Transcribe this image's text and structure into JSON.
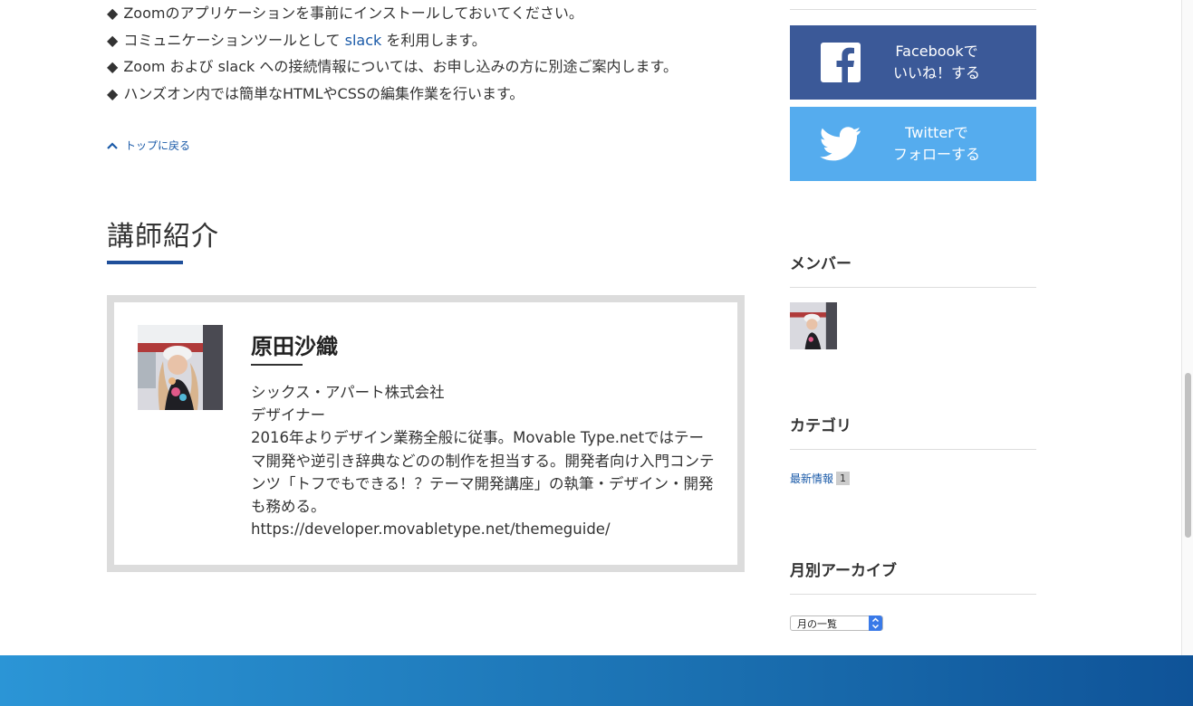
{
  "notes": [
    {
      "prefix": "◆ ",
      "text": "Zoomのアプリケーションを事前にインストールしておいてください。",
      "link": "",
      "suffix": ""
    },
    {
      "prefix": "◆ ",
      "text": "コミュニケーションツールとして ",
      "link": "slack",
      "suffix": " を利用します。"
    },
    {
      "prefix": "◆ ",
      "text": "Zoom および slack への接続情報については、お申し込みの方に別途ご案内します。",
      "link": "",
      "suffix": ""
    },
    {
      "prefix": "◆ ",
      "text": "ハンズオン内では簡単なHTMLやCSSの編集作業を行います。",
      "link": "",
      "suffix": ""
    }
  ],
  "back_to_top": "トップに戻る",
  "section_title": "講師紹介",
  "profile": {
    "name": "原田沙織",
    "lines": [
      "シックス・アパート株式会社",
      "デザイナー",
      "2016年よりデザイン業務全般に従事。Movable Type.netではテーマ開発や逆引き辞典などのの制作を担当する。開発者向け入門コンテンツ「トフでもできる！？テーマ開発講座」の執筆・デザイン・開発も務める。",
      "https://developer.movabletype.net/themeguide/"
    ]
  },
  "sidebar": {
    "facebook": {
      "line1": "Facebookで",
      "line2": "いいね！する"
    },
    "twitter": {
      "line1": "Twitterで",
      "line2": "フォローする"
    },
    "members_title": "メンバー",
    "categories_title": "カテゴリ",
    "category": {
      "label": "最新情報",
      "count": "1"
    },
    "archive_title": "月別アーカイブ",
    "archive_select": "月の一覧"
  },
  "colors": {
    "facebook": "#3b5998",
    "twitter": "#55acee",
    "link": "#1a5aa8",
    "accent": "#1f4f9a"
  }
}
